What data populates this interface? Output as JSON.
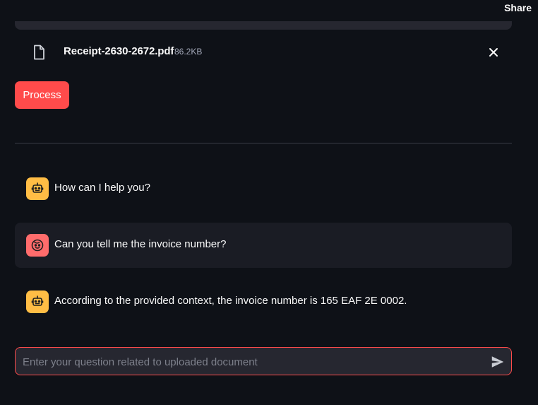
{
  "header": {
    "share_label": "Share"
  },
  "uploaded_file": {
    "name": "Receipt-2630-2672.pdf",
    "size": "86.2KB",
    "icon": "file-icon",
    "remove_icon": "close-icon"
  },
  "process_button": {
    "label": "Process",
    "color": "#ff4b4b"
  },
  "chat": {
    "messages": [
      {
        "role": "assistant",
        "avatar_icon": "bot-icon",
        "text": "How can I help you?"
      },
      {
        "role": "user",
        "avatar_icon": "face-icon",
        "text": "Can you tell me the invoice number?"
      },
      {
        "role": "assistant",
        "avatar_icon": "bot-icon",
        "text": "According to the provided context, the invoice number is 165 EAF 2E 0002."
      }
    ],
    "input": {
      "placeholder": "Enter your question related to uploaded document",
      "value": "",
      "send_icon": "send-icon"
    }
  },
  "colors": {
    "background": "#0e1117",
    "accent": "#ff4b4b",
    "bot_avatar": "#ffbd45",
    "user_avatar": "#ff6c6c"
  }
}
